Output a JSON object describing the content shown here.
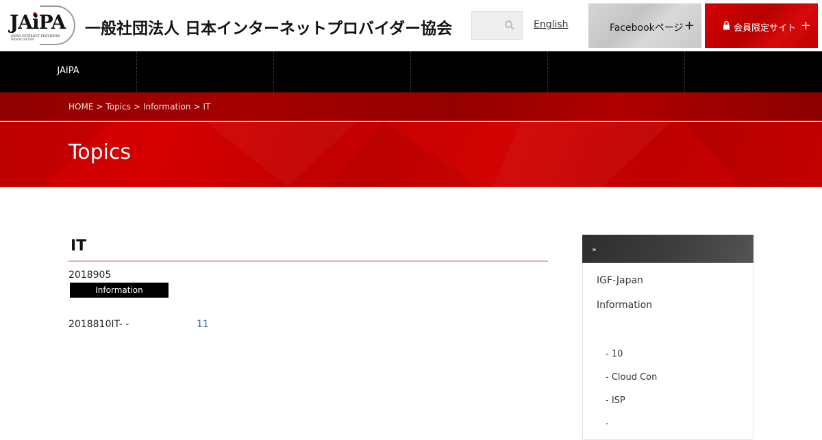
{
  "header": {
    "logo_text": "JAiPA",
    "logo_sub": "JAPAN INTERNET PROVIDERS ASSOCIATION",
    "org_name": "一般社団法人 日本インターネットプロバイダー協会",
    "english_link": "English",
    "facebook_label": "Facebookページ",
    "member_label": "会員限定サイト",
    "plus": "+",
    "search_icon": "search-icon",
    "lock_icon": "lock-icon"
  },
  "nav": {
    "items": [
      {
        "label": "JAIPA"
      },
      {
        "label": ""
      },
      {
        "label": ""
      },
      {
        "label": ""
      },
      {
        "label": ""
      },
      {
        "label": ""
      }
    ]
  },
  "breadcrumb": {
    "items": [
      "HOME",
      "Topics",
      "Information",
      "IT"
    ],
    "separator": ">"
  },
  "page": {
    "title": "Topics"
  },
  "article": {
    "title": "IT",
    "date": "2018905",
    "category": "Information",
    "body": "2018810IT-  -",
    "link_text": "11"
  },
  "sidebar": {
    "head_icon": "»",
    "links": [
      "IGF-Japan",
      "Information"
    ],
    "sub_items": [
      "- 10",
      "- Cloud Con",
      "- ISP",
      "-"
    ]
  },
  "colors": {
    "brand_red": "#c80000",
    "dark_red": "#990000",
    "nav_black": "#000000",
    "link_blue": "#2a6bb8"
  }
}
